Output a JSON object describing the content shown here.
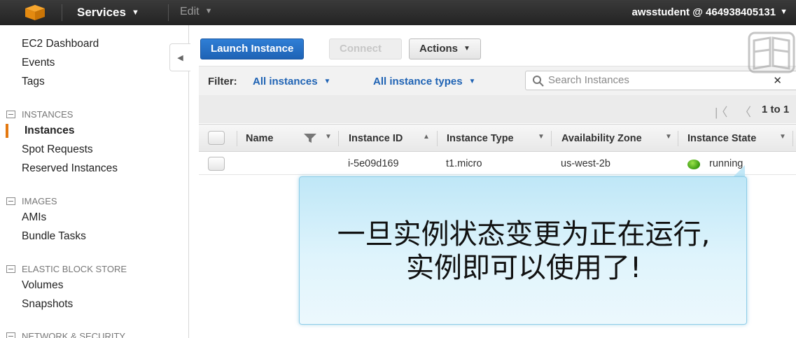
{
  "topbar": {
    "services_label": "Services",
    "edit_label": "Edit",
    "account_label": "awsstudent @ 464938405131",
    "colors": {
      "background": "#2b2b2b",
      "logo": "#f29100"
    }
  },
  "sidebar": {
    "items_top": [
      "EC2 Dashboard",
      "Events",
      "Tags"
    ],
    "sections": [
      {
        "heading": "INSTANCES",
        "items": [
          "Instances",
          "Spot Requests",
          "Reserved Instances"
        ]
      },
      {
        "heading": "IMAGES",
        "items": [
          "AMIs",
          "Bundle Tasks"
        ]
      },
      {
        "heading": "ELASTIC BLOCK STORE",
        "items": [
          "Volumes",
          "Snapshots"
        ]
      },
      {
        "heading": "NETWORK & SECURITY",
        "items": []
      }
    ],
    "active_item": "Instances",
    "accent_color": "#e47911"
  },
  "toolbar": {
    "launch_label": "Launch Instance",
    "connect_label": "Connect",
    "actions_label": "Actions"
  },
  "filter": {
    "label": "Filter:",
    "instances_label": "All instances",
    "types_label": "All instance types",
    "search_placeholder": "Search Instances"
  },
  "pager": {
    "text": "1 to 1"
  },
  "table": {
    "headers": [
      "Name",
      "Instance ID",
      "Instance Type",
      "Availability Zone",
      "Instance State"
    ],
    "rows": [
      {
        "name": "",
        "instance_id": "i-5e09d169",
        "instance_type": "t1.micro",
        "zone": "us-west-2b",
        "state": "running",
        "state_color": "#4caf1a"
      }
    ]
  },
  "overlay": {
    "line1": "一旦实例状态变更为正在运行,",
    "line2": "实例即可以使用了!"
  },
  "icons": [
    "aws-cube-logo-icon",
    "chevron-down-icon",
    "collapse-arrow-icon",
    "search-icon",
    "close-icon",
    "first-page-icon",
    "prev-page-icon",
    "filter-icon",
    "sort-asc-icon",
    "book-logo-icon"
  ]
}
